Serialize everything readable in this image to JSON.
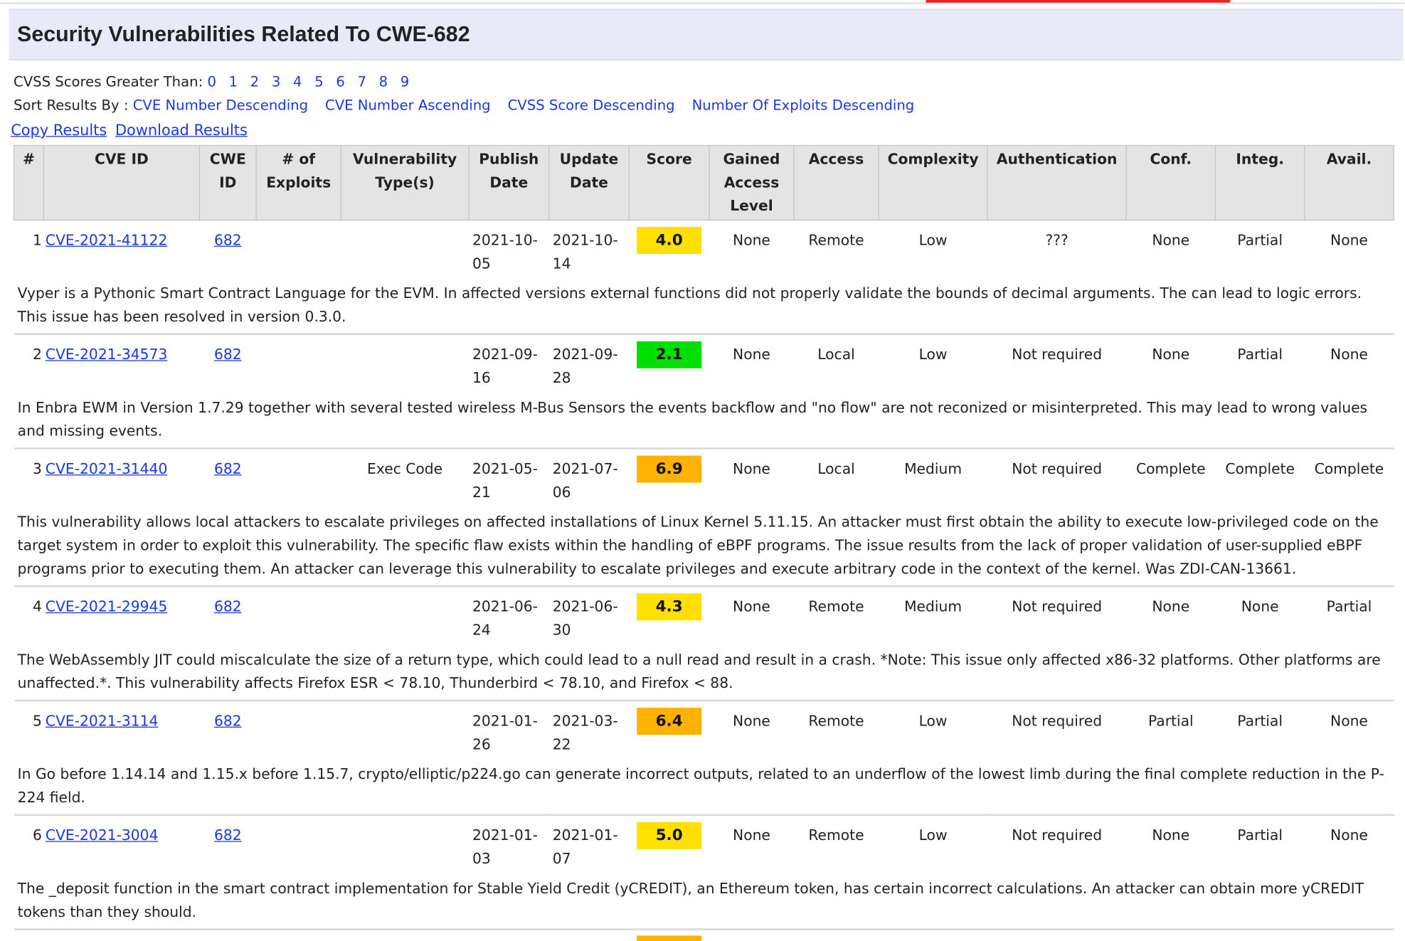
{
  "page": {
    "title": "Security Vulnerabilities Related To CWE-682"
  },
  "filters": {
    "cvss_label": "CVSS Scores Greater Than:",
    "cvss_scores": [
      "0",
      "1",
      "2",
      "3",
      "4",
      "5",
      "6",
      "7",
      "8",
      "9"
    ],
    "sort_label": "Sort Results By :",
    "sort_options": [
      "CVE Number Descending",
      "CVE Number Ascending",
      "CVSS Score Descending",
      "Number Of Exploits Descending"
    ]
  },
  "actions": {
    "copy": "Copy Results",
    "download": "Download Results"
  },
  "colors": {
    "header_bg": "#e9eaf8",
    "link": "#1a37e0",
    "score_low": "#00e000",
    "score_medium": "#ffe000",
    "score_high": "#ffb300"
  },
  "table": {
    "columns": [
      "#",
      "CVE ID",
      "CWE ID",
      "# of Exploits",
      "Vulnerability Type(s)",
      "Publish Date",
      "Update Date",
      "Score",
      "Gained Access Level",
      "Access",
      "Complexity",
      "Authentication",
      "Conf.",
      "Integ.",
      "Avail."
    ],
    "rows": [
      {
        "num": "1",
        "cve": "CVE-2021-41122",
        "cwe": "682",
        "exploits": "",
        "type": "",
        "publish": "2021-10-05",
        "update": "2021-10-14",
        "score": "4.0",
        "score_color": "#ffe000",
        "gained": "None",
        "access": "Remote",
        "complexity": "Low",
        "auth": "???",
        "conf": "None",
        "integ": "Partial",
        "avail": "None",
        "summary": "Vyper is a Pythonic Smart Contract Language for the EVM. In affected versions external functions did not properly validate the bounds of decimal arguments. The can lead to logic errors. This issue has been resolved in version 0.3.0."
      },
      {
        "num": "2",
        "cve": "CVE-2021-34573",
        "cwe": "682",
        "exploits": "",
        "type": "",
        "publish": "2021-09-16",
        "update": "2021-09-28",
        "score": "2.1",
        "score_color": "#00e000",
        "gained": "None",
        "access": "Local",
        "complexity": "Low",
        "auth": "Not required",
        "conf": "None",
        "integ": "Partial",
        "avail": "None",
        "summary": "In Enbra EWM in Version 1.7.29 together with several tested wireless M-Bus Sensors the events backflow and \"no flow\" are not reconized or misinterpreted. This may lead to wrong values and missing events."
      },
      {
        "num": "3",
        "cve": "CVE-2021-31440",
        "cwe": "682",
        "exploits": "",
        "type": "Exec Code",
        "publish": "2021-05-21",
        "update": "2021-07-06",
        "score": "6.9",
        "score_color": "#ffb300",
        "gained": "None",
        "access": "Local",
        "complexity": "Medium",
        "auth": "Not required",
        "conf": "Complete",
        "integ": "Complete",
        "avail": "Complete",
        "summary": "This vulnerability allows local attackers to escalate privileges on affected installations of Linux Kernel 5.11.15. An attacker must first obtain the ability to execute low-privileged code on the target system in order to exploit this vulnerability. The specific flaw exists within the handling of eBPF programs. The issue results from the lack of proper validation of user-supplied eBPF programs prior to executing them. An attacker can leverage this vulnerability to escalate privileges and execute arbitrary code in the context of the kernel. Was ZDI-CAN-13661."
      },
      {
        "num": "4",
        "cve": "CVE-2021-29945",
        "cwe": "682",
        "exploits": "",
        "type": "",
        "publish": "2021-06-24",
        "update": "2021-06-30",
        "score": "4.3",
        "score_color": "#ffe000",
        "gained": "None",
        "access": "Remote",
        "complexity": "Medium",
        "auth": "Not required",
        "conf": "None",
        "integ": "None",
        "avail": "Partial",
        "summary": "The WebAssembly JIT could miscalculate the size of a return type, which could lead to a null read and result in a crash. *Note: This issue only affected x86-32 platforms. Other platforms are unaffected.*. This vulnerability affects Firefox ESR < 78.10, Thunderbird < 78.10, and Firefox < 88."
      },
      {
        "num": "5",
        "cve": "CVE-2021-3114",
        "cwe": "682",
        "exploits": "",
        "type": "",
        "publish": "2021-01-26",
        "update": "2021-03-22",
        "score": "6.4",
        "score_color": "#ffb300",
        "gained": "None",
        "access": "Remote",
        "complexity": "Low",
        "auth": "Not required",
        "conf": "Partial",
        "integ": "Partial",
        "avail": "None",
        "summary": "In Go before 1.14.14 and 1.15.x before 1.15.7, crypto/elliptic/p224.go can generate incorrect outputs, related to an underflow of the lowest limb during the final complete reduction in the P-224 field."
      },
      {
        "num": "6",
        "cve": "CVE-2021-3004",
        "cwe": "682",
        "exploits": "",
        "type": "",
        "publish": "2021-01-03",
        "update": "2021-01-07",
        "score": "5.0",
        "score_color": "#ffe000",
        "gained": "None",
        "access": "Remote",
        "complexity": "Low",
        "auth": "Not required",
        "conf": "None",
        "integ": "Partial",
        "avail": "None",
        "summary": "The _deposit function in the smart contract implementation for Stable Yield Credit (yCREDIT), an Ethereum token, has certain incorrect calculations. An attacker can obtain more yCREDIT tokens than they should."
      }
    ],
    "partial_row_score_color": "#ffb300"
  }
}
